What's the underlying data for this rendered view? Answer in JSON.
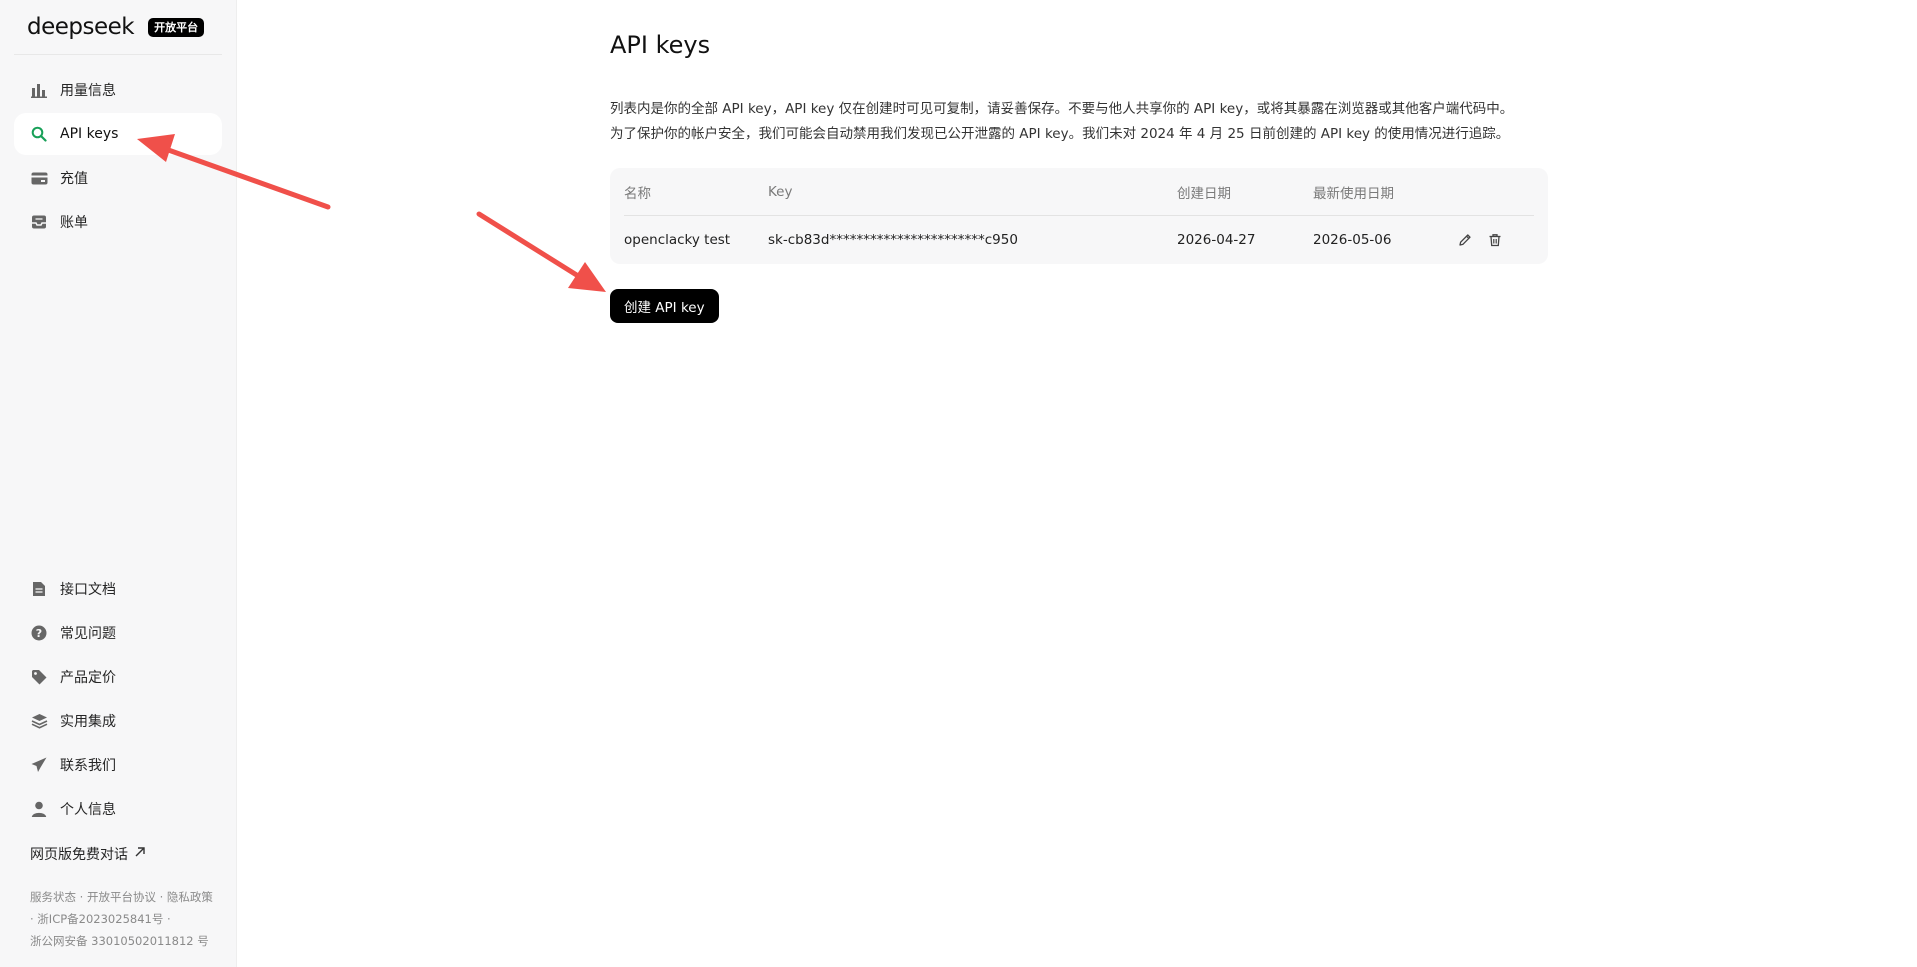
{
  "brand": {
    "logo_text": "deepseek",
    "badge": "开放平台"
  },
  "sidebar": {
    "items": [
      {
        "label": "用量信息",
        "icon": "bar-chart-icon",
        "active": false
      },
      {
        "label": "API keys",
        "icon": "search-key-icon",
        "active": true
      },
      {
        "label": "充值",
        "icon": "wallet-icon",
        "active": false
      },
      {
        "label": "账单",
        "icon": "inbox-icon",
        "active": false
      }
    ],
    "bottom_items": [
      {
        "label": "接口文档",
        "icon": "document-icon"
      },
      {
        "label": "常见问题",
        "icon": "question-icon"
      },
      {
        "label": "产品定价",
        "icon": "tag-icon"
      },
      {
        "label": "实用集成",
        "icon": "layers-icon"
      },
      {
        "label": "联系我们",
        "icon": "send-icon"
      },
      {
        "label": "个人信息",
        "icon": "user-icon"
      }
    ],
    "chat_link": "网页版免费对话",
    "footer": {
      "line1": "服务状态 · 开放平台协议 · 隐私政策",
      "line2": " · 浙ICP备2023025841号 · ",
      "line3": "浙公网安备 33010502011812 号"
    }
  },
  "main": {
    "title": "API keys",
    "desc_line1": "列表内是你的全部 API key，API key 仅在创建时可见可复制，请妥善保存。不要与他人共享你的 API key，或将其暴露在浏览器或其他客户端代码中。",
    "desc_line2": "为了保护你的帐户安全，我们可能会自动禁用我们发现已公开泄露的 API key。我们未对 2024 年 4 月 25 日前创建的 API key 的使用情况进行追踪。",
    "table": {
      "headers": {
        "name": "名称",
        "key": "Key",
        "created": "创建日期",
        "last_used": "最新使用日期"
      },
      "rows": [
        {
          "name": "openclacky test",
          "key": "sk-cb83d***********************c950",
          "created": "2026-04-27",
          "last_used": "2026-05-06"
        }
      ]
    },
    "create_button": "创建 API key"
  },
  "annotations": {
    "arrow_color": "#f0504a"
  }
}
